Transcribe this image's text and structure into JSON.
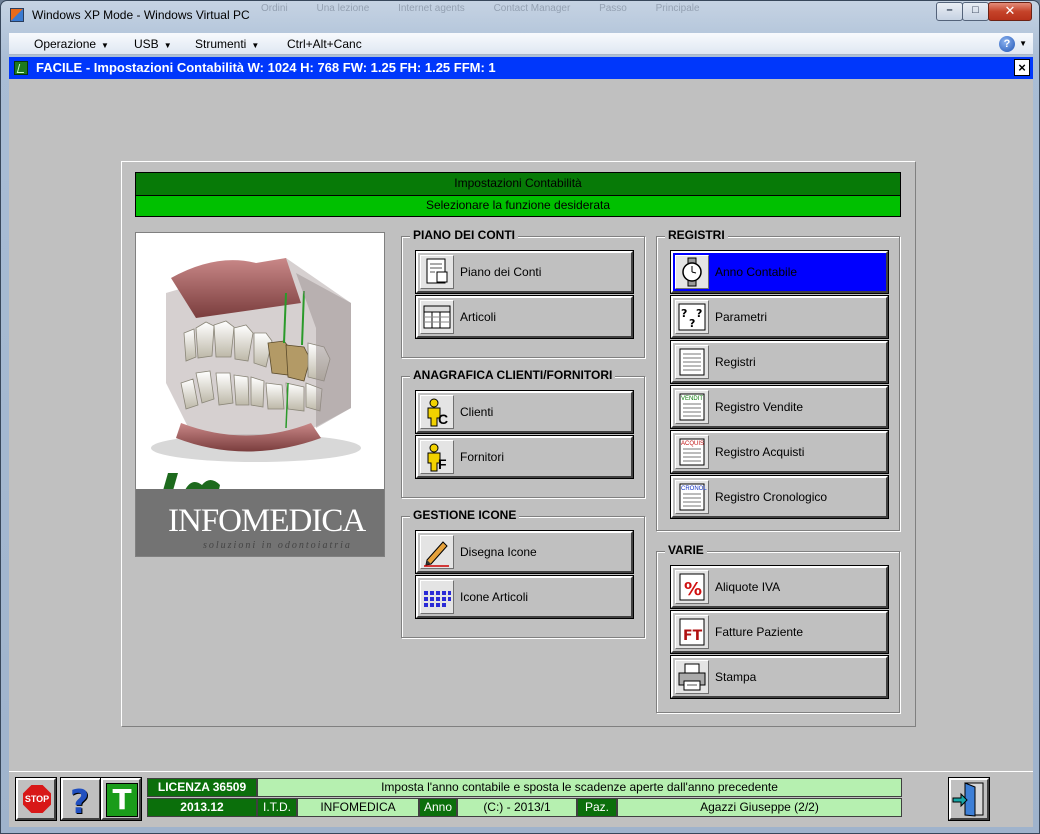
{
  "window": {
    "title": "Windows XP Mode - Windows Virtual PC",
    "ghost_tabs": [
      "Ordini",
      "Una lezione",
      "Internet agents",
      "Contact Manager",
      "Passo",
      "Principale"
    ]
  },
  "menubar": {
    "items": [
      {
        "label": "Operazione",
        "has_arrow": true
      },
      {
        "label": "USB",
        "has_arrow": true
      },
      {
        "label": "Strumenti",
        "has_arrow": true
      },
      {
        "label": "Ctrl+Alt+Canc",
        "has_arrow": false
      }
    ]
  },
  "app": {
    "title": "FACILE - Impostazioni Contabilità W: 1024 H: 768 FW: 1.25 FH: 1.25 FFM:  1",
    "close_glyph": "×"
  },
  "header": {
    "title": "Impostazioni Contabilità",
    "subtitle": "Selezionare la funzione desiderata"
  },
  "logo": {
    "brand": "INFOMEDICA",
    "tagline": "soluzioni in odontoiatria"
  },
  "groups": {
    "piano": {
      "title": "PIANO DEI CONTI",
      "buttons": [
        {
          "label": "Piano dei Conti",
          "icon": "ledger-icon"
        },
        {
          "label": "Articoli",
          "icon": "articles-table-icon"
        }
      ]
    },
    "anagrafica": {
      "title": "ANAGRAFICA CLIENTI/FORNITORI",
      "buttons": [
        {
          "label": "Clienti",
          "icon": "person-c-icon"
        },
        {
          "label": "Fornitori",
          "icon": "person-f-icon"
        }
      ]
    },
    "icone": {
      "title": "GESTIONE ICONE",
      "buttons": [
        {
          "label": "Disegna Icone",
          "icon": "pencil-icon"
        },
        {
          "label": "Icone Articoli",
          "icon": "icon-grid-icon"
        }
      ]
    },
    "registri": {
      "title": "REGISTRI",
      "buttons": [
        {
          "label": "Anno Contabile",
          "icon": "watch-icon",
          "selected": true
        },
        {
          "label": "Parametri",
          "icon": "question-sheet-icon"
        },
        {
          "label": "Registri",
          "icon": "register-book-icon"
        },
        {
          "label": "Registro Vendite",
          "icon": "sales-register-icon",
          "tag": "VENDIT"
        },
        {
          "label": "Registro Acquisti",
          "icon": "purchase-register-icon",
          "tag": "ACQUIS"
        },
        {
          "label": "Registro Cronologico",
          "icon": "chrono-register-icon",
          "tag": "CRONOL"
        }
      ]
    },
    "varie": {
      "title": "VARIE",
      "buttons": [
        {
          "label": "Aliquote IVA",
          "icon": "percent-icon"
        },
        {
          "label": "Fatture Paziente",
          "icon": "invoice-ft-icon"
        },
        {
          "label": "Stampa",
          "icon": "printer-icon"
        }
      ]
    }
  },
  "statusbar": {
    "stop_label": "STOP",
    "license": "LICENZA 36509",
    "message": "Imposta l'anno contabile e sposta le scadenze aperte dall'anno precedente",
    "version": "2013.12",
    "itd_label": "I.T.D.",
    "company": "INFOMEDICA",
    "anno_label": "Anno",
    "anno_value": "(C:) - 2013/1",
    "paz_label": "Paz.",
    "patient": "Agazzi Giuseppe (2/2)"
  },
  "colors": {
    "selected_button": "#0000ff",
    "header_dark_green": "#077a07",
    "header_light_green": "#00c000",
    "app_titlebar": "#0037fb"
  }
}
